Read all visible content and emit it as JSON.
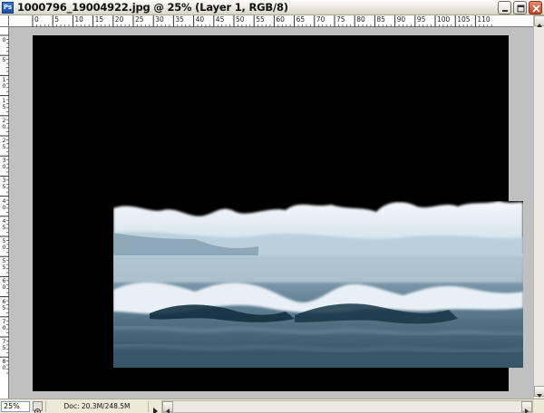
{
  "window": {
    "title": "1000796_19004922.jpg @ 25% (Layer 1, RGB/8)",
    "app_icon_label": "Ps"
  },
  "rulers": {
    "top_labels": [
      "0",
      "5",
      "10",
      "15",
      "20",
      "25",
      "30",
      "35",
      "40",
      "45",
      "50",
      "55",
      "60",
      "65",
      "70",
      "75",
      "80",
      "85",
      "90",
      "95",
      "100",
      "105",
      "110"
    ],
    "left_labels": [
      "0",
      "5",
      "10",
      "15",
      "20",
      "25",
      "30",
      "35",
      "40",
      "45",
      "50",
      "55",
      "60",
      "65",
      "70",
      "75",
      "80"
    ]
  },
  "status": {
    "zoom": "25%",
    "doc_size": "Doc: 20.3M/248.5M"
  },
  "colors": {
    "canvas_bg": "#c0c0c0",
    "document_bg": "#000000",
    "close_button": "#d0502c"
  },
  "icons": {
    "minimize": "minimize-icon",
    "maximize": "maximize-icon",
    "close": "close-icon",
    "navigator": "navigator-icon",
    "doc_menu": "triangle-right-icon"
  }
}
